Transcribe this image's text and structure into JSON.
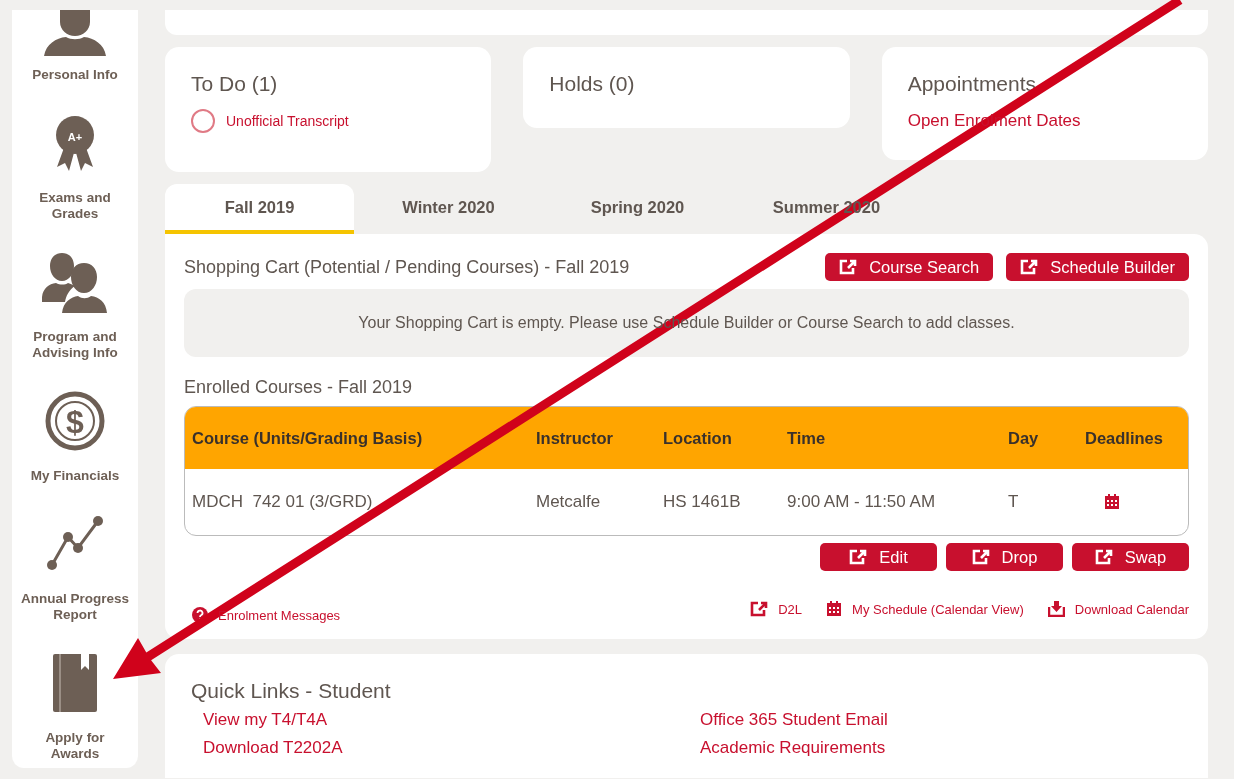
{
  "sidebar": {
    "items": [
      {
        "label": "Personal Info",
        "kind": "person"
      },
      {
        "label": "Exams and Grades",
        "kind": "award",
        "glyph": "A+"
      },
      {
        "label": "Program and Advising Info",
        "kind": "people"
      },
      {
        "label": "My Financials",
        "kind": "coin",
        "glyph": "$"
      },
      {
        "label": "Annual Progress Report",
        "kind": "progress"
      },
      {
        "label": "Apply for Awards",
        "kind": "book"
      }
    ]
  },
  "summary_cards": [
    {
      "title": "To Do (1)",
      "links": [
        {
          "label": "Unofficial Transcript",
          "kind": "todo"
        }
      ]
    },
    {
      "title": "Holds (0)"
    },
    {
      "title": "Appointments",
      "links": [
        {
          "label": "Open Enrolment Dates",
          "kind": "plain"
        }
      ]
    }
  ],
  "term_tabs": [
    {
      "label": "Fall 2019",
      "selected": true
    },
    {
      "label": "Winter 2020",
      "selected": false
    },
    {
      "label": "Spring 2020",
      "selected": false
    },
    {
      "label": "Summer 2020",
      "selected": false
    }
  ],
  "shopping_cart": {
    "title": "Shopping Cart (Potential / Pending Courses) - Fall 2019",
    "buttons": [
      "Course Search",
      "Schedule Builder"
    ],
    "message": "Your Shopping Cart is empty. Please use Schedule Builder or Course Search to add classes."
  },
  "enrolled": {
    "title": "Enrolled Courses - Fall 2019",
    "columns": [
      "Course (Units/Grading Basis)",
      "Instructor",
      "Location",
      "Time",
      "Day",
      "Deadlines"
    ],
    "rows": [
      {
        "cells": [
          "MDCH  742 01 (3/GRD)",
          "Metcalfe",
          "HS 1461B",
          "9:00 AM - 11:50 AM",
          "T"
        ]
      }
    ],
    "buttons": [
      "Edit",
      "Drop",
      "Swap"
    ]
  },
  "footer_links": [
    {
      "label": "Enrolment Messages",
      "kind": "help"
    },
    {
      "label": "D2L",
      "kind": "external"
    },
    {
      "label": "My Schedule (Calendar View)",
      "kind": "calendar"
    },
    {
      "label": "Download Calendar",
      "kind": "download"
    }
  ],
  "quick_links": {
    "title": "Quick Links - Student",
    "links": [
      "View my T4/T4A",
      "Office 365 Student Email",
      "Download T2202A",
      "Academic Requirements"
    ]
  }
}
